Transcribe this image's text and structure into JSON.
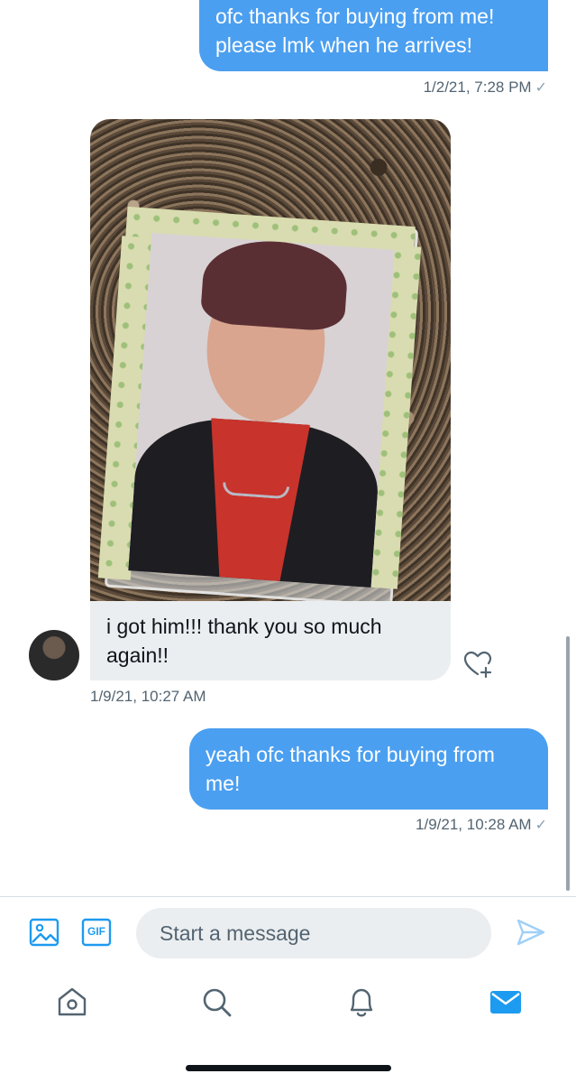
{
  "conversation": {
    "messages": [
      {
        "direction": "outgoing",
        "lines": [
          "ofc thanks for buying from me!",
          "please lmk when he arrives!"
        ],
        "timestamp": "1/2/21, 7:28 PM",
        "status": "✓"
      },
      {
        "direction": "incoming",
        "has_photo": true,
        "lines": [
          "i got him!!! thank you so much",
          "again!!"
        ],
        "timestamp": "1/9/21, 10:27 AM"
      },
      {
        "direction": "outgoing",
        "lines": [
          "yeah ofc thanks for buying from",
          "me!"
        ],
        "timestamp": "1/9/21, 10:28 AM",
        "status": "✓"
      }
    ]
  },
  "composer": {
    "placeholder": "Start a message",
    "gif_label": "GIF"
  },
  "colors": {
    "accent": "#1d9bf0",
    "outgoing_bubble": "#4b9ff0",
    "incoming_bubble": "#ebeef0",
    "muted_text": "#536471"
  },
  "icons": {
    "composer": [
      "image-icon",
      "gif-icon",
      "send-icon"
    ],
    "tabs": [
      "home-icon",
      "search-icon",
      "bell-icon",
      "mail-icon"
    ],
    "reaction": "heart-plus-icon"
  }
}
